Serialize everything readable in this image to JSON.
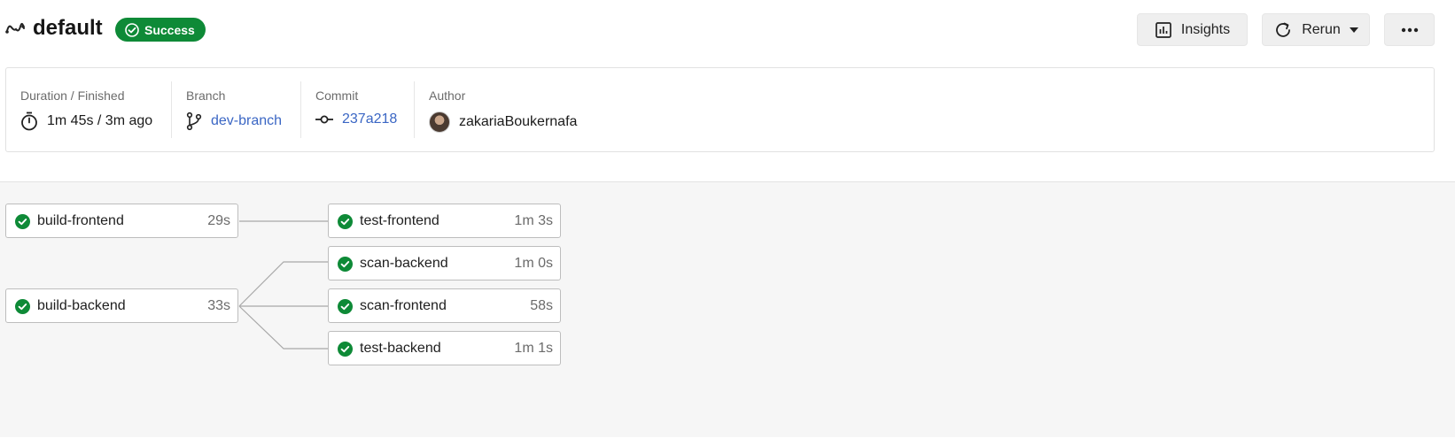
{
  "header": {
    "workflow_name": "default",
    "status": "Success",
    "status_color": "#0e8a37",
    "insights_label": "Insights",
    "rerun_label": "Rerun",
    "more_icon": "ellipsis-icon"
  },
  "meta": {
    "duration": {
      "label": "Duration / Finished",
      "value": "1m 45s / 3m ago",
      "icon": "stopwatch-icon"
    },
    "branch": {
      "label": "Branch",
      "value": "dev-branch",
      "icon": "branch-icon"
    },
    "commit": {
      "label": "Commit",
      "value": "237a218",
      "icon": "commit-icon"
    },
    "author": {
      "label": "Author",
      "value": "zakariaBoukernafa"
    }
  },
  "jobs": {
    "build_frontend": {
      "name": "build-frontend",
      "duration": "29s",
      "status": "success"
    },
    "build_backend": {
      "name": "build-backend",
      "duration": "33s",
      "status": "success"
    },
    "test_frontend": {
      "name": "test-frontend",
      "duration": "1m 3s",
      "status": "success"
    },
    "scan_backend": {
      "name": "scan-backend",
      "duration": "1m 0s",
      "status": "success"
    },
    "scan_frontend": {
      "name": "scan-frontend",
      "duration": "58s",
      "status": "success"
    },
    "test_backend": {
      "name": "test-backend",
      "duration": "1m 1s",
      "status": "success"
    }
  },
  "colors": {
    "success": "#0e8a37",
    "link": "#3a66c4",
    "canvas_bg": "#f6f6f6"
  }
}
